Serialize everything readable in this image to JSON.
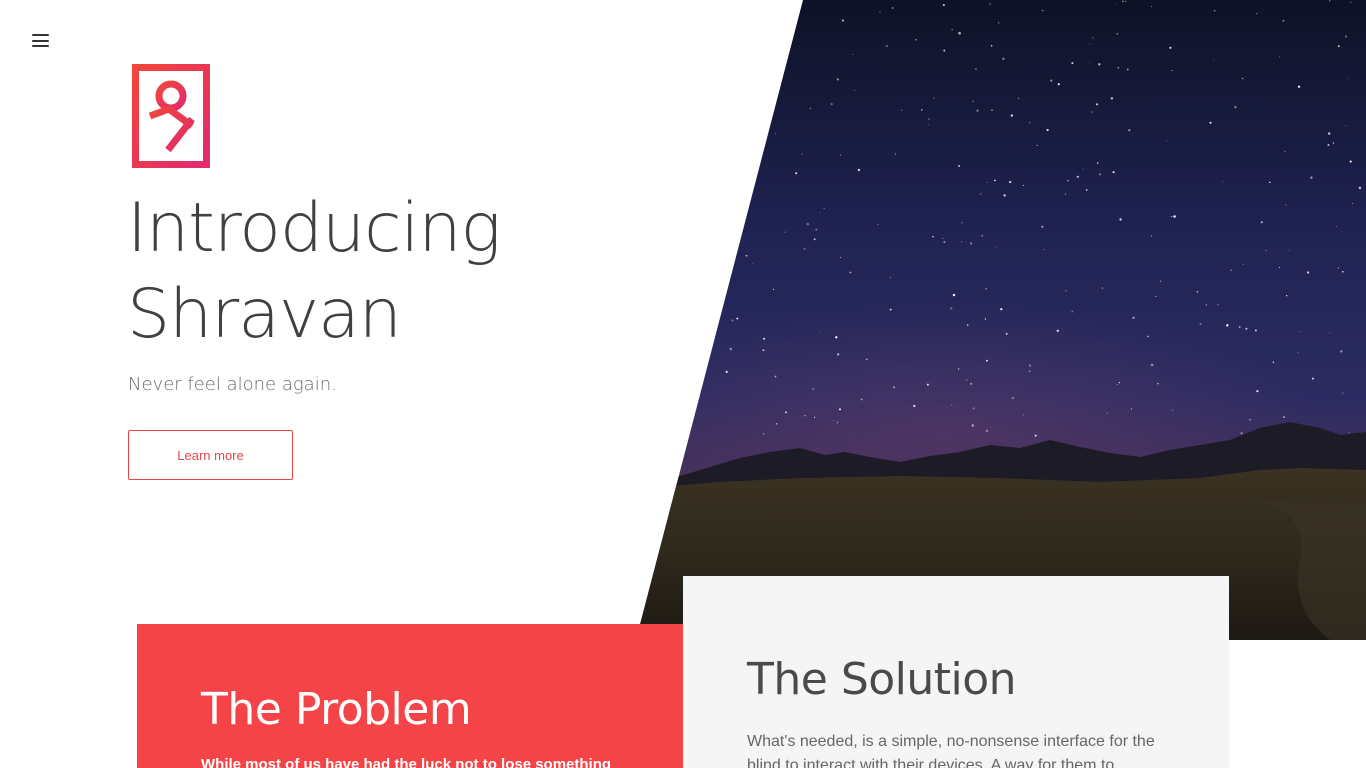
{
  "menu": {
    "icon": "hamburger-menu-icon"
  },
  "logo": {
    "icon": "shravan-logo-icon",
    "color_start": "#f0463c",
    "color_end": "#e22a6e"
  },
  "hero": {
    "title_line1": "Introducing",
    "title_line2": "Shravan",
    "tagline": "Never feel alone again.",
    "cta_label": "Learn more",
    "accent": "#e8464b"
  },
  "sections": {
    "problem": {
      "title": "The Problem",
      "text": "While most of us have had the luck not to lose something",
      "background": "#f44448"
    },
    "solution": {
      "title": "The Solution",
      "text": "What's needed, is a simple, no-nonsense interface for the blind to interact with their devices. A way for them to",
      "background": "#f5f5f5"
    }
  }
}
